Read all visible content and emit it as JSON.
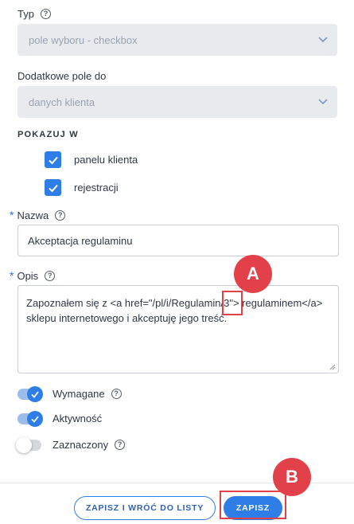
{
  "type_field": {
    "label": "Typ",
    "value": "pole wyboru - checkbox"
  },
  "extra_field": {
    "label": "Dodatkowe pole do",
    "value": "danych klienta"
  },
  "show_in": {
    "title": "POKAZUJ W",
    "options": [
      {
        "label": "panelu klienta",
        "checked": true
      },
      {
        "label": "rejestracji",
        "checked": true
      }
    ]
  },
  "name_field": {
    "required_mark": "*",
    "label": "Nazwa",
    "value": "Akceptacja regulaminu"
  },
  "description_field": {
    "required_mark": "*",
    "label": "Opis",
    "value": "Zapoznałem się z <a href=\"/pl/i/Regulamin/3\"> regulaminem</a> sklepu internetowego i akceptuję jego treść."
  },
  "toggles": [
    {
      "label": "Wymagane",
      "on": true
    },
    {
      "label": "Aktywność",
      "on": true
    },
    {
      "label": "Zaznaczony",
      "on": false
    }
  ],
  "actions": {
    "save_and_back_label": "ZAPISZ I WRÓĆ DO LISTY",
    "save_label": "ZAPISZ"
  },
  "annotations": {
    "marker_a": "A",
    "marker_b": "B"
  },
  "colors": {
    "accent": "#2f7ee8",
    "marker": "#e2414a",
    "disabled_bg": "#e8eaed"
  }
}
